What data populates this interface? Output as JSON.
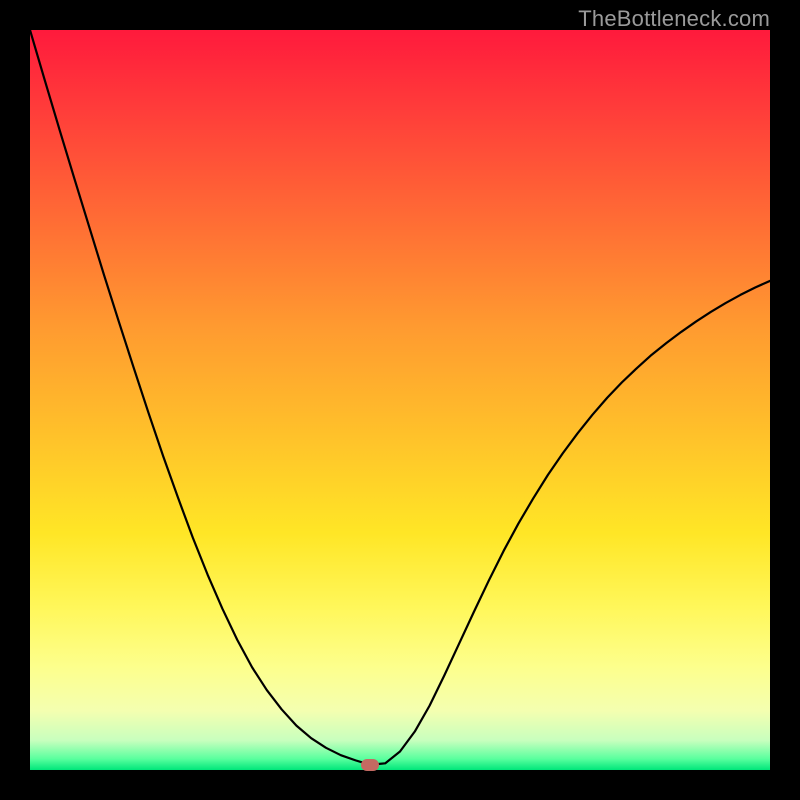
{
  "watermark": "TheBottleneck.com",
  "colors": {
    "background": "#000000",
    "curve_stroke": "#000000",
    "marker_fill": "#c46a62",
    "gradient_top": "#ff1a3c",
    "gradient_bottom": "#00e67a"
  },
  "chart_data": {
    "type": "line",
    "title": "",
    "xlabel": "",
    "ylabel": "",
    "xlim": [
      0,
      100
    ],
    "ylim": [
      0,
      100
    ],
    "x": [
      0,
      2,
      4,
      6,
      8,
      10,
      12,
      14,
      16,
      18,
      20,
      22,
      24,
      26,
      28,
      30,
      32,
      34,
      36,
      38,
      40,
      42,
      44,
      46,
      48,
      50,
      52,
      54,
      56,
      58,
      60,
      62,
      64,
      66,
      68,
      70,
      72,
      74,
      76,
      78,
      80,
      82,
      84,
      86,
      88,
      90,
      92,
      94,
      96,
      98,
      100
    ],
    "values": [
      100,
      93.2,
      86.5,
      79.9,
      73.4,
      66.9,
      60.6,
      54.4,
      48.3,
      42.4,
      36.8,
      31.4,
      26.4,
      21.8,
      17.6,
      13.9,
      10.8,
      8.2,
      6.0,
      4.3,
      3.0,
      2.0,
      1.3,
      0.7,
      0.9,
      2.5,
      5.2,
      8.7,
      12.8,
      17.1,
      21.4,
      25.6,
      29.6,
      33.3,
      36.7,
      39.9,
      42.8,
      45.5,
      48.0,
      50.3,
      52.4,
      54.3,
      56.1,
      57.7,
      59.2,
      60.6,
      61.9,
      63.1,
      64.2,
      65.2,
      66.1
    ],
    "marker": {
      "x": 46,
      "y": 0.7
    },
    "grid": false,
    "legend": false
  }
}
